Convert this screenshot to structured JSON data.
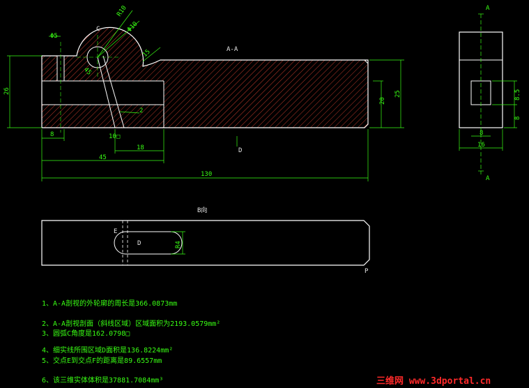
{
  "colors": {
    "background": "#000000",
    "outline": "#ffffff",
    "dimension": "#39ff14",
    "hatch": "#c0392b",
    "watermark": "#ff2a2a"
  },
  "section_view": {
    "title": "A-A",
    "labels": {
      "c": "C",
      "d_arrow": "D"
    },
    "dims": {
      "r10": "R10",
      "phi10": "Φ10",
      "phi5": "Φ5",
      "ang45": "45",
      "ang15": "15",
      "h26": "26",
      "h20": "20",
      "h25": "25",
      "w8": "8",
      "w45": "45",
      "w18": "18",
      "w130": "130",
      "d2": "2",
      "d10": "10□"
    }
  },
  "side_view": {
    "section_a_top": "A",
    "section_a_bottom": "A",
    "dims": {
      "h85": "8.5",
      "h8": "8",
      "w8": "8",
      "w16": "16"
    }
  },
  "bottom_view": {
    "title": "B向",
    "labels": {
      "e": "E",
      "d": "D",
      "p": "P",
      "r4": "R4"
    }
  },
  "notes": [
    "1、A-A剖视的外轮廓的周长是366.0873mm",
    "2、A-A剖视剖面（斜线区域）区域面积为2193.0579mm²",
    "3、圆弧C角度是162.0798□",
    "4、细实线所围区域D面积是136.8224mm²",
    "5、交点E到交点F的距离是89.6557mm",
    "6、该三维实体体积是37881.7084mm³"
  ],
  "watermark": "三维网 www.3dportal.cn"
}
